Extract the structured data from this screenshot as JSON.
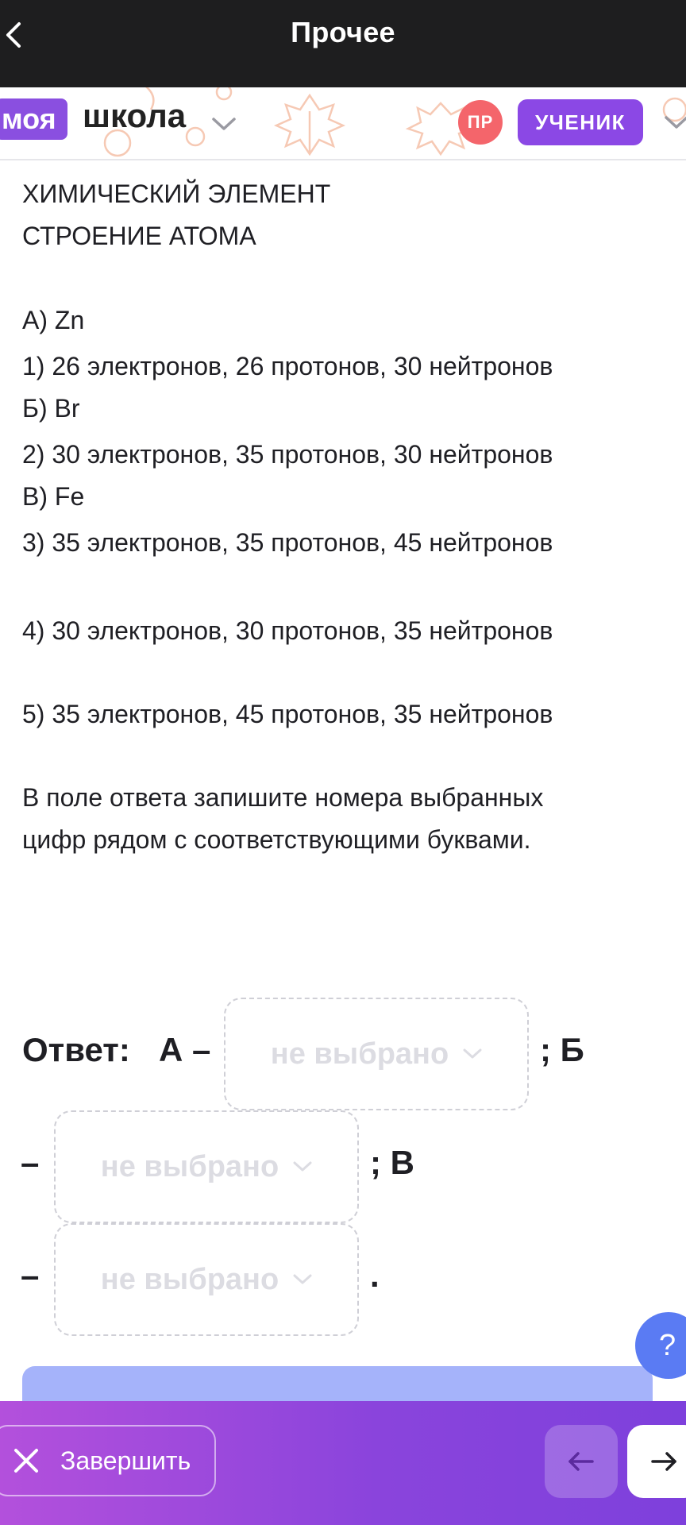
{
  "header": {
    "title": "Прочее",
    "back_icon": "chevron-left-icon"
  },
  "school": {
    "logo_part1": "моя",
    "logo_part2": "школа",
    "avatar_initials": "ПР",
    "role": "УЧЕНИК",
    "accent": "#8b48e5",
    "avatar_color": "#f4656b"
  },
  "task": {
    "lines": [
      "ХИМИЧЕСКИЙ ЭЛЕМЕНТ",
      "СТРОЕНИЕ АТОМА",
      "",
      "А) Zn",
      "1) 26 электронов, 26 протонов, 30 нейтронов",
      "Б) Br",
      "2) 30 электронов, 35 протонов, 30 нейтронов",
      "В) Fe",
      "3) 35 электронов, 35 протонов, 45 нейтронов",
      "",
      "4) 30 электронов, 30 протонов, 35 нейтронов",
      "",
      "5) 35 электронов, 45 протонов, 35 нейтронов"
    ],
    "instruction": [
      "В поле ответа запишите номера выбранных",
      "цифр рядом с соответствующими буквами."
    ]
  },
  "answer": {
    "label": "Ответ:",
    "letter_a": "А –",
    "sep_b": ";  Б",
    "dash_b": "–",
    "sep_c": ";  В",
    "dash_c": "–",
    "end": ".",
    "select_a": "не выбрано",
    "select_b": "не выбрано",
    "select_c": "не выбрано"
  },
  "help": {
    "label": "?"
  },
  "footer": {
    "finish_label": "Завершить",
    "prev_icon": "arrow-left-icon",
    "next_icon": "arrow-right-icon"
  }
}
